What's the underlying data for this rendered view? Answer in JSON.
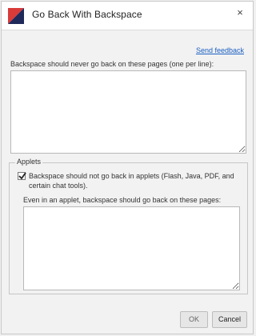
{
  "dialog": {
    "title": "Go Back With Backspace",
    "close_glyph": "×",
    "feedback_link": "Send feedback",
    "main_label": "Backspace should never go back on these pages (one per line):",
    "main_textarea_value": "",
    "applets": {
      "legend": "Applets",
      "checkbox_checked": true,
      "checkbox_label": "Backspace should not go back in applets (Flash, Java, PDF, and certain chat tools).",
      "sub_label": "Even in an applet, backspace should go back on these pages:",
      "sub_textarea_value": ""
    },
    "buttons": {
      "ok": "OK",
      "cancel": "Cancel"
    }
  },
  "icons": {
    "logo": "backspace-extension-logo-icon",
    "close": "close-icon",
    "check": "checkmark-icon"
  },
  "colors": {
    "logo_red": "#d93a3a",
    "logo_navy": "#1f2a5a",
    "link": "#1a5fc1"
  }
}
